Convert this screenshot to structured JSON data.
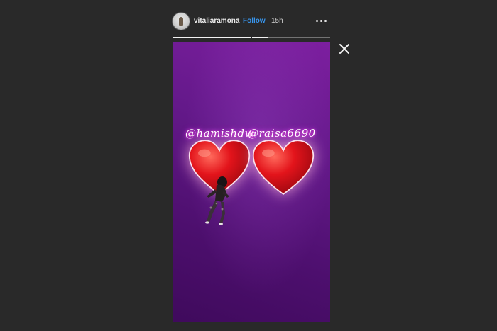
{
  "header": {
    "username": "vitaliaramona",
    "separator": "•",
    "follow_label": "Follow",
    "timestamp": "15h",
    "avatar_icon": "profile-avatar-icon",
    "more_icon": "more-options-icon"
  },
  "progress": {
    "segments": [
      {
        "progress": 1.0
      },
      {
        "progress": 0.2
      }
    ]
  },
  "story": {
    "background_color": "#64198a",
    "mentions": [
      "@hamishdw",
      "@raisa6690"
    ],
    "stickers": [
      "red-heart-icon",
      "red-heart-icon",
      "dancing-figure-sticker"
    ]
  },
  "controls": {
    "close_icon": "close-icon"
  },
  "colors": {
    "page_background": "#292929",
    "follow_blue": "#3897f0",
    "heart_red": "#e3141b"
  }
}
